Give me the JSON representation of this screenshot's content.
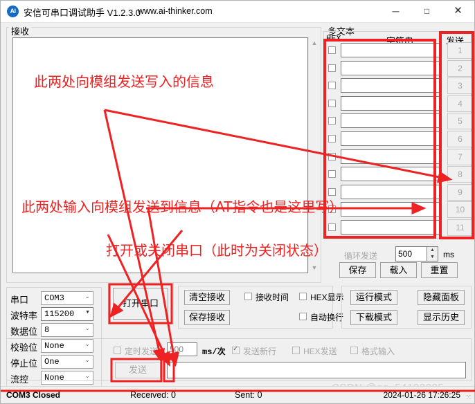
{
  "window": {
    "logo_text": "AI",
    "title": "安信可串口调试助手 V1.2.3.0",
    "url": "www.ai-thinker.com",
    "minimize": "─",
    "maximize": "□",
    "close": "✕"
  },
  "receive": {
    "group_label": "接收",
    "content": "",
    "scroll_up": "▲",
    "scroll_down": "▼"
  },
  "multitext": {
    "group_label": "多文本",
    "col_hex": "HEX",
    "col_string": "字符串",
    "col_send": "发送",
    "rows": [
      {
        "hex_checked": false,
        "value": "",
        "send_label": "1"
      },
      {
        "hex_checked": false,
        "value": "",
        "send_label": "2"
      },
      {
        "hex_checked": false,
        "value": "",
        "send_label": "3"
      },
      {
        "hex_checked": false,
        "value": "",
        "send_label": "4"
      },
      {
        "hex_checked": false,
        "value": "",
        "send_label": "5"
      },
      {
        "hex_checked": false,
        "value": "",
        "send_label": "6"
      },
      {
        "hex_checked": false,
        "value": "",
        "send_label": "7"
      },
      {
        "hex_checked": false,
        "value": "",
        "send_label": "8"
      },
      {
        "hex_checked": false,
        "value": "",
        "send_label": "9"
      },
      {
        "hex_checked": false,
        "value": "",
        "send_label": "10"
      },
      {
        "hex_checked": false,
        "value": "",
        "send_label": "11"
      }
    ],
    "interval_label": "循环发送",
    "interval_value": "500",
    "spin_up": "▲",
    "spin_down": "▼",
    "unit": "ms",
    "save_label": "保存",
    "load_label": "载入",
    "reset_label": "重置"
  },
  "params": [
    {
      "label": "串口",
      "value": "COM3",
      "editable": false,
      "chevron": "⌄"
    },
    {
      "label": "波特率",
      "value": "115200",
      "editable": true,
      "chevron": "▼"
    },
    {
      "label": "数据位",
      "value": "8",
      "editable": false,
      "chevron": "⌄"
    },
    {
      "label": "校验位",
      "value": "None",
      "editable": false,
      "chevron": "⌄"
    },
    {
      "label": "停止位",
      "value": "One",
      "editable": false,
      "chevron": "⌄"
    },
    {
      "label": "流控",
      "value": "None",
      "editable": false,
      "chevron": "⌄"
    }
  ],
  "open_button": {
    "label": "打开串口"
  },
  "options": {
    "clear_receive": "清空接收",
    "save_receive": "保存接收",
    "recv_time": {
      "label": "接收时间",
      "checked": false
    },
    "hex_display": {
      "label": "HEX显示",
      "checked": false
    },
    "auto_wrap": {
      "label": "自动换行",
      "checked": false
    }
  },
  "modes": {
    "run_mode": "运行模式",
    "download_mode": "下载模式",
    "hide_panel": "隐藏面板",
    "show_history": "显示历史"
  },
  "send": {
    "timed_send": {
      "label": "定时发送",
      "checked": false
    },
    "interval_value": "500",
    "unit": "ms/次",
    "send_newline": {
      "label": "发送新行",
      "checked": true
    },
    "hex_send": {
      "label": "HEX发送",
      "checked": false
    },
    "format_input": {
      "label": "格式输入",
      "checked": false
    },
    "send_button": "发送",
    "input_value": ""
  },
  "status": {
    "connection": "COM3 Closed",
    "received": "Received: 0",
    "sent": "Sent: 0",
    "datetime": "2024-01-26 17:26:25",
    "grip": "⁙"
  },
  "watermark": "CSDN @qq_54193285",
  "annotations": {
    "note1": "此两处向模组发送写入的信息",
    "note2": "此两处输入向模组发送到信息（AT指令也是这里写）",
    "note3": "打开或关闭串口（此时为关闭状态）"
  }
}
